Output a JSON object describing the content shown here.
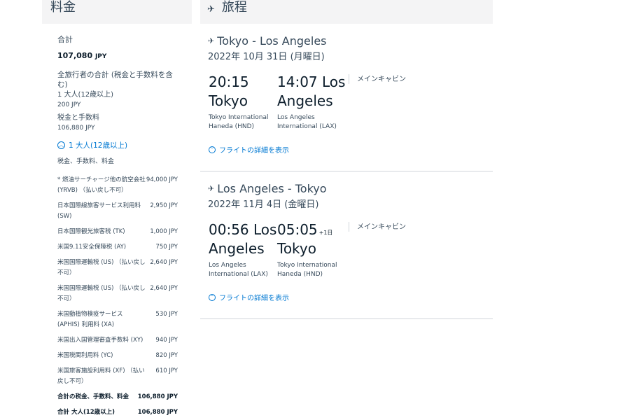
{
  "pricing": {
    "title": "料金",
    "total_label": "合計",
    "total_amount": "107,080",
    "total_currency": "JPY",
    "all_travelers_label": "全旅行者の合計 (税金と手数料を含む)",
    "adult_label": "1 大人(12歳以上)",
    "adult_fare": "200 JPY",
    "taxes_label": "税金と手数料",
    "taxes_amount": "106,880 JPY",
    "toggle_label": "1 大人(12歳以上)",
    "breakdown_caption": "税金、手数料、料金",
    "tax_items": [
      {
        "name": "* 燃油サーチャージ他の航空会社 (YRVB) （払い戻し不可）",
        "amount": "94,000 JPY"
      },
      {
        "name": "日本国際線旅客サービス利用料 (SW)",
        "amount": "2,950 JPY"
      },
      {
        "name": "日本国際観光旅客税 (TK)",
        "amount": "1,000 JPY"
      },
      {
        "name": "米国9.11安全保障税 (AY)",
        "amount": "750 JPY"
      },
      {
        "name": "米国国際運輸税 (US) （払い戻し不可）",
        "amount": "2,640 JPY"
      },
      {
        "name": "米国国際運輸税 (US) （払い戻し不可）",
        "amount": "2,640 JPY"
      },
      {
        "name": "米国動植物検疫サービス (APHIS) 利用料 (XA)",
        "amount": "530 JPY"
      },
      {
        "name": "米国出入国管理審査手数料 (XY)",
        "amount": "940 JPY"
      },
      {
        "name": "米国税関利用料 (YC)",
        "amount": "820 JPY"
      },
      {
        "name": "米国旅客施設利用料 (XF) （払い戻し不可）",
        "amount": "610 JPY"
      }
    ],
    "total_taxes_label": "合計の税金、手数料、料金",
    "total_taxes_amount": "106,880 JPY",
    "total_adult_label": "合計 大人(12歳以上)",
    "total_adult_amount": "106,880 JPY"
  },
  "itinerary": {
    "title": "旅程",
    "segments": [
      {
        "route": "Tokyo - Los Angeles",
        "date": "2022年 10月 31日 (月曜日)",
        "dep_time": "20:15",
        "dep_city": "Tokyo",
        "dep_airport": "Tokyo International Haneda (HND)",
        "arr_time": "14:07",
        "arr_city": "Los Angeles",
        "arr_day_offset": "",
        "arr_airport": "Los Angeles International (LAX)",
        "cabin": "メインキャビン",
        "details_link": "フライトの詳細を表示"
      },
      {
        "route": "Los Angeles - Tokyo",
        "date": "2022年 11月 4日 (金曜日)",
        "dep_time": "00:56",
        "dep_city": "Los Angeles",
        "dep_airport": "Los Angeles International (LAX)",
        "arr_time": "05:05",
        "arr_city": "Tokyo",
        "arr_day_offset": "+1日",
        "arr_airport": "Tokyo International Haneda (HND)",
        "cabin": "メインキャビン",
        "details_link": "フライトの詳細を表示"
      }
    ]
  },
  "colors": {
    "link": "#0078d2",
    "text": "#36495a",
    "panel": "#f4f4f5",
    "divider": "#d0d5da"
  },
  "icons": {
    "plane": "plane-icon",
    "chevron_up": "chevron-up-icon",
    "chevron_down": "chevron-down-icon"
  }
}
